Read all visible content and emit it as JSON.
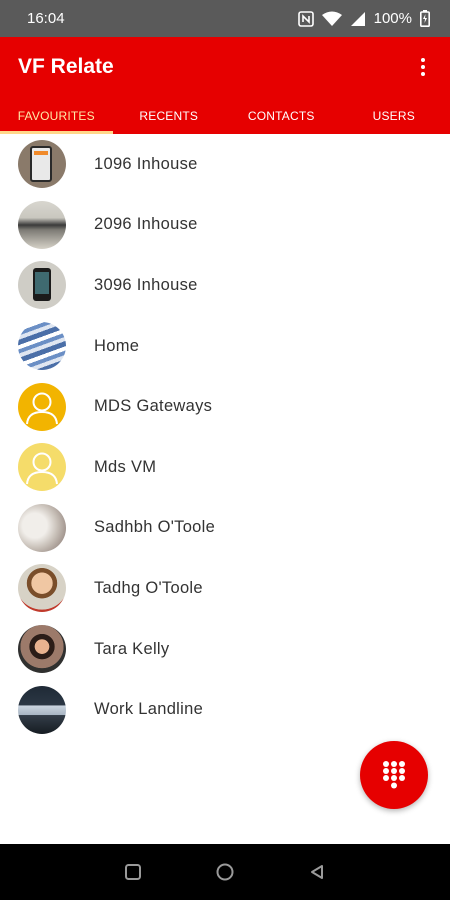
{
  "status_bar": {
    "time": "16:04",
    "battery": "100%",
    "icons": [
      "nfc-icon",
      "wifi-icon",
      "cell-signal-icon",
      "battery-icon"
    ]
  },
  "app": {
    "title": "VF Relate",
    "accent_color": "#e60000",
    "active_tab_color": "#ffd78a"
  },
  "tabs": [
    {
      "label": "FAVOURITES",
      "active": true
    },
    {
      "label": "RECENTS",
      "active": false
    },
    {
      "label": "CONTACTS",
      "active": false
    },
    {
      "label": "USERS",
      "active": false
    }
  ],
  "favourites": [
    {
      "name": "1096 Inhouse",
      "avatar": "photo-phone-screen"
    },
    {
      "name": "2096 Inhouse",
      "avatar": "photo-device"
    },
    {
      "name": "3096 Inhouse",
      "avatar": "photo-mobile-phone"
    },
    {
      "name": "Home",
      "avatar": "photo-sky"
    },
    {
      "name": "MDS Gateways",
      "avatar": "default-person-icon"
    },
    {
      "name": "Mds VM",
      "avatar": "default-person-icon"
    },
    {
      "name": "Sadhbh O'Toole",
      "avatar": "photo-person"
    },
    {
      "name": "Tadhg O'Toole",
      "avatar": "photo-person"
    },
    {
      "name": "Tara Kelly",
      "avatar": "photo-person"
    },
    {
      "name": "Work Landline",
      "avatar": "photo-desk"
    }
  ],
  "fab": {
    "icon": "dialpad-icon"
  },
  "nav_bar": {
    "icons": [
      "recents-square-icon",
      "home-circle-icon",
      "back-triangle-icon"
    ]
  }
}
